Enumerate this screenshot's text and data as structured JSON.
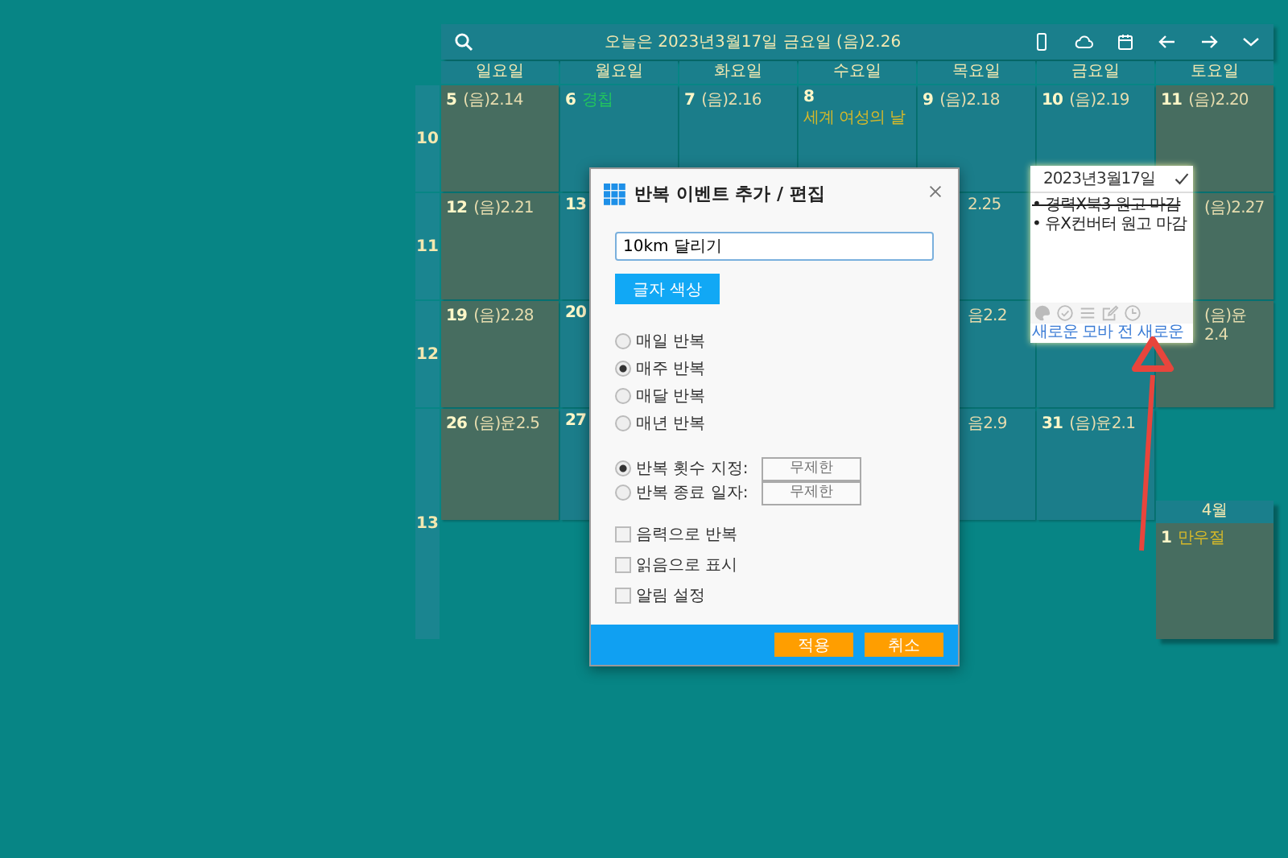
{
  "header": {
    "title": "오늘은 2023년3월17일 금요일 (음)2.26"
  },
  "weekdays": [
    "일요일",
    "월요일",
    "화요일",
    "수요일",
    "목요일",
    "금요일",
    "토요일"
  ],
  "weeks": [
    {
      "number": "10",
      "days": [
        {
          "kind": "full",
          "day": "5",
          "lunar": "(음)2.14"
        },
        {
          "kind": "full",
          "day": "6",
          "note": "경칩",
          "color": "#22c55e"
        },
        {
          "kind": "full",
          "day": "7",
          "lunar": "(음)2.16"
        },
        {
          "kind": "full",
          "day": "8",
          "note": "세계 여성의 날",
          "color": "#d4b82a"
        },
        {
          "kind": "full",
          "day": "9",
          "lunar": "(음)2.18"
        },
        {
          "kind": "full",
          "day": "10",
          "lunar": "(음)2.19"
        },
        {
          "kind": "full",
          "day": "11",
          "lunar": "(음)2.20"
        }
      ]
    },
    {
      "number": "11",
      "days": [
        {
          "kind": "full",
          "day": "12",
          "lunar": "(음)2.21"
        },
        {
          "kind": "full",
          "day": "13"
        },
        {
          "kind": "blank"
        },
        {
          "kind": "blank"
        },
        {
          "kind": "partial",
          "lunar": "2.25"
        },
        {
          "kind": "blank"
        },
        {
          "kind": "partial",
          "lunar": "(음)2.27"
        }
      ]
    },
    {
      "number": "12",
      "days": [
        {
          "kind": "full",
          "day": "19",
          "lunar": "(음)2.28"
        },
        {
          "kind": "full",
          "day": "20"
        },
        {
          "kind": "blank"
        },
        {
          "kind": "blank"
        },
        {
          "kind": "partial",
          "lunar": "음2.2"
        },
        {
          "kind": "empty"
        },
        {
          "kind": "partial",
          "lunar": "(음)윤2.4"
        }
      ]
    },
    {
      "number": "13",
      "days": [
        {
          "kind": "full",
          "day": "26",
          "lunar": "(음)윤2.5"
        },
        {
          "kind": "full",
          "day": "27"
        },
        {
          "kind": "blank"
        },
        {
          "kind": "blank"
        },
        {
          "kind": "partial",
          "lunar": "음2.9"
        },
        {
          "kind": "full",
          "day": "31",
          "lunar": "(음)윤2.1"
        }
      ]
    }
  ],
  "next_month": {
    "title": "4월",
    "day": "1",
    "note": "만우절",
    "color": "#d4b82a"
  },
  "day_popup": {
    "date": "2023년3월17일",
    "items": [
      {
        "text": "• 경력X북3 원고 마감",
        "done": true
      },
      {
        "text": "• 유X컨버터 원고 마감",
        "done": false
      }
    ],
    "links": [
      "새로운 모바",
      "전 새로운"
    ]
  },
  "dialog": {
    "title": "반복 이벤트 추가 / 편집",
    "name_value": "10km 달리기",
    "color_button": "글자 색상",
    "frequency": [
      {
        "label": "매일 반복",
        "selected": false
      },
      {
        "label": "매주 반복",
        "selected": true
      },
      {
        "label": "매달 반복",
        "selected": false
      },
      {
        "label": "매년 반복",
        "selected": false
      }
    ],
    "end_rule": [
      {
        "label": "반복 횟수 지정:",
        "selected": true,
        "placeholder": "무제한"
      },
      {
        "label": "반복 종료 일자:",
        "selected": false,
        "placeholder": "무제한"
      }
    ],
    "options": [
      {
        "label": "음력으로 반복",
        "checked": false
      },
      {
        "label": "읽음으로 표시",
        "checked": false
      },
      {
        "label": "알림 설정",
        "checked": false
      }
    ],
    "buttons": [
      "적용",
      "취소"
    ]
  }
}
